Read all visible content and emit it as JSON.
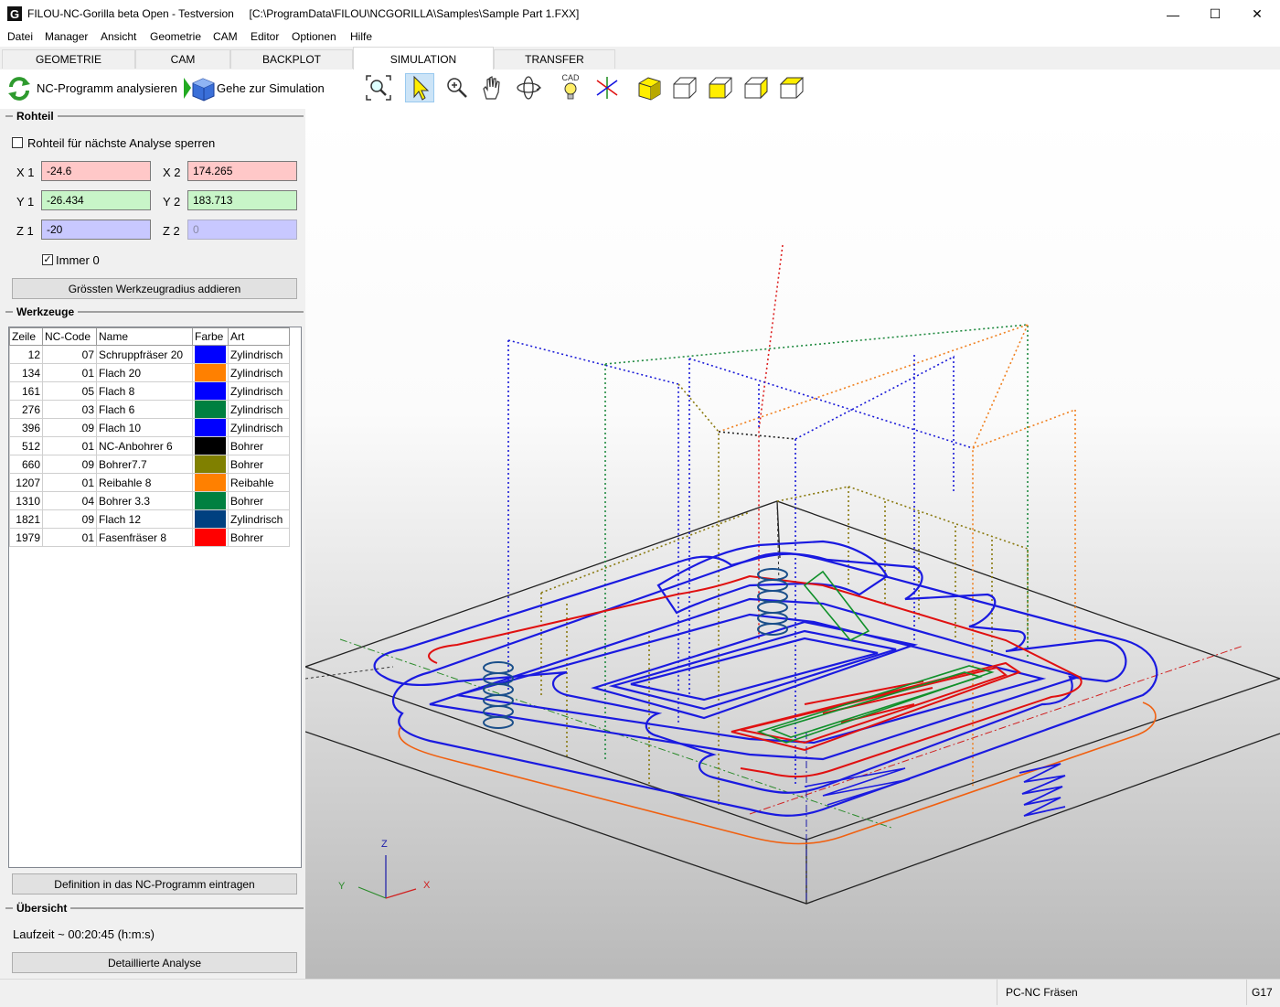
{
  "window": {
    "title": "FILOU-NC-Gorilla beta Open - Testversion     [C:\\ProgramData\\FILOU\\NCGORILLA\\Samples\\Sample Part 1.FXX]",
    "logo_letter": "G",
    "minimize": "—",
    "maximize": "☐",
    "close": "✕"
  },
  "menu": [
    "Datei",
    "Manager",
    "Ansicht",
    "Geometrie",
    "CAM",
    "Editor",
    "Optionen",
    "Hilfe"
  ],
  "tabs": [
    "GEOMETRIE",
    "CAM",
    "BACKPLOT",
    "SIMULATION",
    "TRANSFER"
  ],
  "active_tab": "SIMULATION",
  "toolbar": {
    "analyze_label": "NC-Programm analysieren",
    "goto_sim_label": "Gehe zur Simulation",
    "cad_label": "CAD"
  },
  "rohteil": {
    "title": "Rohteil",
    "lock_label": "Rohteil für nächste Analyse sperren",
    "lock_checked": false,
    "x1_label": "X 1",
    "x1": "-24.6",
    "x2_label": "X 2",
    "x2": "174.265",
    "y1_label": "Y 1",
    "y1": "-26.434",
    "y2_label": "Y 2",
    "y2": "183.713",
    "z1_label": "Z 1",
    "z1": "-20",
    "z2_label": "Z 2",
    "z2": "0",
    "immer0_label": "Immer 0",
    "immer0_checked": true,
    "radius_button": "Grössten Werkzeugradius addieren",
    "x_color": "#ffc8c8",
    "y_color": "#c8f5c8",
    "z_color": "#c8c8ff"
  },
  "werkzeuge": {
    "title": "Werkzeuge",
    "columns": [
      "Zeile",
      "NC-Code",
      "Name",
      "Farbe",
      "Art"
    ],
    "rows": [
      {
        "zeile": "12",
        "code": "07",
        "name": "Schruppfräser 20",
        "color": "#0000ff",
        "art": "Zylindrisch"
      },
      {
        "zeile": "134",
        "code": "01",
        "name": "Flach 20",
        "color": "#ff8000",
        "art": "Zylindrisch"
      },
      {
        "zeile": "161",
        "code": "05",
        "name": "Flach 8",
        "color": "#0000ff",
        "art": "Zylindrisch"
      },
      {
        "zeile": "276",
        "code": "03",
        "name": "Flach 6",
        "color": "#008040",
        "art": "Zylindrisch"
      },
      {
        "zeile": "396",
        "code": "09",
        "name": "Flach 10",
        "color": "#0000ff",
        "art": "Zylindrisch"
      },
      {
        "zeile": "512",
        "code": "01",
        "name": "NC-Anbohrer 6",
        "color": "#000000",
        "art": "Bohrer"
      },
      {
        "zeile": "660",
        "code": "09",
        "name": "Bohrer7.7",
        "color": "#808000",
        "art": "Bohrer"
      },
      {
        "zeile": "1207",
        "code": "01",
        "name": "Reibahle 8",
        "color": "#ff8000",
        "art": "Reibahle"
      },
      {
        "zeile": "1310",
        "code": "04",
        "name": "Bohrer 3.3",
        "color": "#008040",
        "art": "Bohrer"
      },
      {
        "zeile": "1821",
        "code": "09",
        "name": "Flach 12",
        "color": "#004080",
        "art": "Zylindrisch"
      },
      {
        "zeile": "1979",
        "code": "01",
        "name": "Fasenfräser 8",
        "color": "#ff0000",
        "art": "Bohrer"
      }
    ],
    "define_button": "Definition in das NC-Programm eintragen"
  },
  "uebersicht": {
    "title": "Übersicht",
    "laufzeit": "Laufzeit ~ 00:20:45 (h:m:s)",
    "detail_button": "Detaillierte Analyse"
  },
  "axes": {
    "z": "Z",
    "y": "Y",
    "x": "X"
  },
  "status": {
    "mode": "PC-NC Fräsen",
    "code": "G17"
  }
}
